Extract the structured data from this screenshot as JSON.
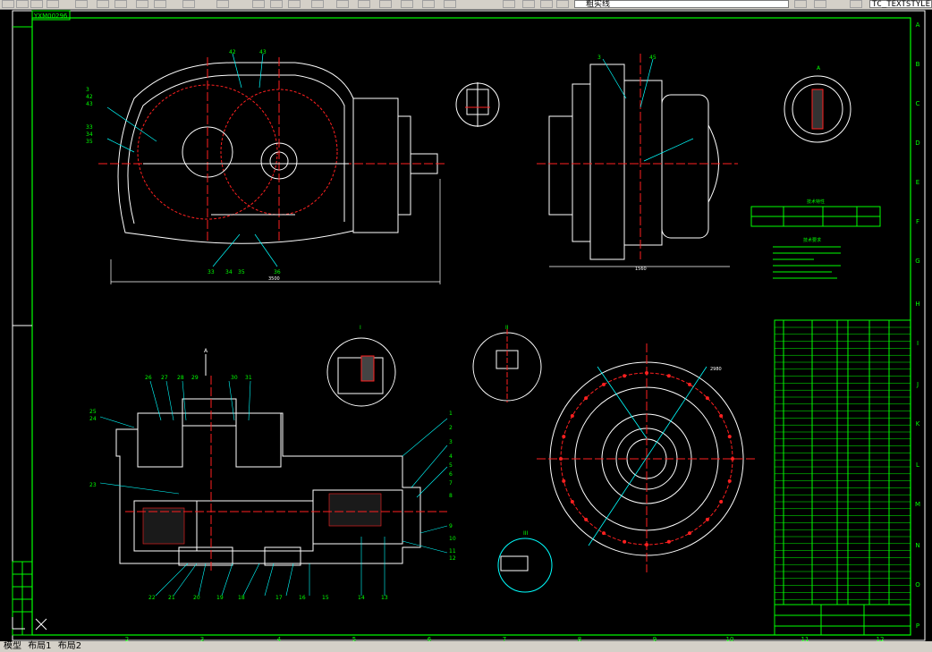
{
  "toolbar": {
    "layer_value": "粗实线",
    "textstyle_value": "TC_TEXTSTYLE"
  },
  "drawing": {
    "title_block_name": "YXM00296",
    "tech_table_title": "技术特性",
    "tech_req_title": "技术要求",
    "section_labels": [
      "A",
      "I",
      "II",
      "III",
      "IV"
    ],
    "dim_front_width": "3500",
    "dim_side_width": "1560",
    "dim_flange": "2980",
    "frame_letters_right": [
      "A",
      "B",
      "C",
      "D",
      "E",
      "F",
      "G",
      "H",
      "I",
      "J",
      "K",
      "L",
      "M",
      "N",
      "O",
      "P"
    ],
    "frame_numbers_bottom": [
      "2",
      "3",
      "4",
      "5",
      "6",
      "7",
      "8",
      "9",
      "10",
      "11",
      "12"
    ],
    "callouts_top": [
      "42",
      "43",
      "3",
      "44",
      "45",
      "36",
      "37",
      "38",
      "33",
      "34",
      "35",
      "36"
    ],
    "callouts_bottom": [
      "26",
      "27",
      "28",
      "29",
      "30",
      "31",
      "25",
      "24",
      "1",
      "2",
      "3",
      "4",
      "5",
      "6",
      "7",
      "8",
      "9",
      "10",
      "11",
      "12",
      "13",
      "14",
      "15",
      "16",
      "17",
      "18",
      "19",
      "20",
      "21",
      "22",
      "23"
    ]
  },
  "tabs": {
    "model": "模型",
    "layout1": "布局1",
    "layout2": "布局2"
  }
}
